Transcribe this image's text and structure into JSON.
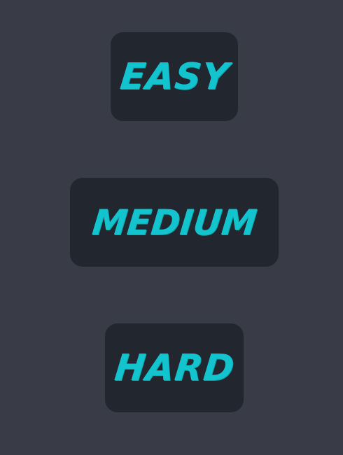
{
  "menu": {
    "buttons": [
      {
        "label": "EASY"
      },
      {
        "label": "MEDIUM"
      },
      {
        "label": "HARD"
      }
    ]
  },
  "colors": {
    "background": "#393c46",
    "button_background": "#22262f",
    "label_accent": "#13c3cd"
  }
}
